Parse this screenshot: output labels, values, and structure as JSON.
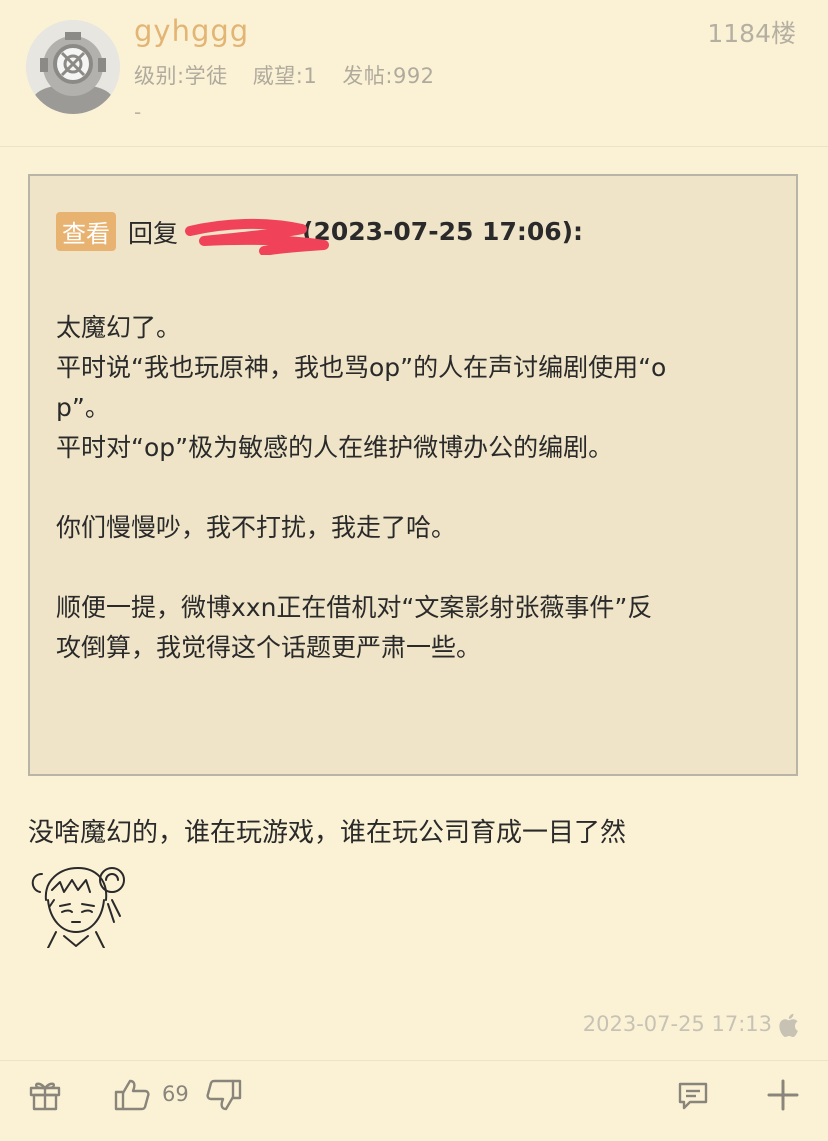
{
  "post": {
    "username": "gyhggg",
    "level": "级别:学徒",
    "prestige": "威望:1",
    "posts": "发帖:992",
    "signature": "-",
    "floor": "1184楼"
  },
  "quote": {
    "view_label": "查看",
    "reply_label": "回复",
    "reply_date": "(2023-07-25 17:06):",
    "lines": [
      "太魔幻了。",
      "平时说“我也玩原神，我也骂op”的人在声讨编剧使用“o",
      "p”。",
      "平时对“op”极为敏感的人在维护微博办公的编剧。",
      "",
      "你们慢慢吵，我不打扰，我走了哈。",
      "",
      "顺便一提，微博xxn正在借机对“文案影射张薇事件”反",
      "攻倒算，我觉得这个话题更严肃一些。"
    ]
  },
  "reply_text": "没啥魔幻的，谁在玩游戏，谁在玩公司育成一目了然",
  "timestamp": "2023-07-25 17:13",
  "actions": {
    "like_count": "69"
  },
  "colors": {
    "background": "#fbf2d6",
    "username": "#e3b575",
    "quote_bg": "#efe4c8",
    "view_button": "#e8b270",
    "redaction": "#f0435a"
  },
  "icons": [
    "avatar-diving-helmet",
    "gift-icon",
    "thumbs-up-icon",
    "thumbs-down-icon",
    "comment-icon",
    "plus-icon",
    "apple-icon",
    "sticker-anime-girl"
  ]
}
